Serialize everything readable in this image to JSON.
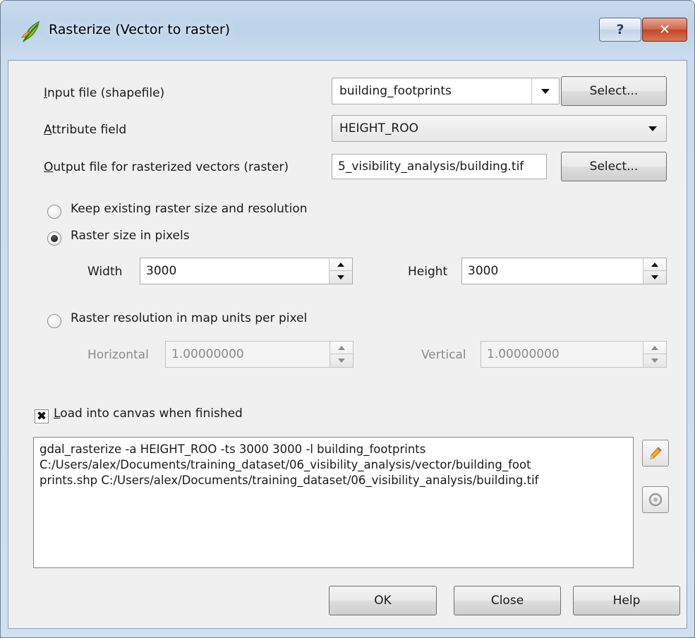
{
  "window": {
    "title": "Rasterize (Vector to raster)",
    "help_glyph": "?",
    "close_glyph": "✕",
    "icon": "qgis-leaf-icon"
  },
  "form": {
    "input_file": {
      "label_ul": "I",
      "label_rest": "nput file (shapefile)",
      "value": "building_footprints",
      "select_label": "Select..."
    },
    "attribute_field": {
      "label_ul": "A",
      "label_rest": "ttribute field",
      "value": "HEIGHT_ROO"
    },
    "output_file": {
      "label_ul": "O",
      "label_rest": "utput file for rasterized vectors (raster)",
      "value": "5_visibility_analysis/building.tif",
      "select_label": "Select..."
    }
  },
  "raster_options": {
    "keep_existing": {
      "label": "Keep existing raster size and resolution",
      "checked": false
    },
    "size_in_pixels": {
      "label": "Raster size in pixels",
      "checked": true
    },
    "width_label": "Width",
    "width_value": "3000",
    "height_label": "Height",
    "height_value": "3000",
    "resolution": {
      "label": "Raster resolution in map units per pixel",
      "checked": false
    },
    "horizontal_label": "Horizontal",
    "horizontal_value": "1.00000000",
    "vertical_label": "Vertical",
    "vertical_value": "1.00000000"
  },
  "load_canvas": {
    "checked": true,
    "mark": "✖",
    "label_ul": "L",
    "label_rest": "oad into canvas when finished"
  },
  "command": {
    "text": "gdal_rasterize -a HEIGHT_ROO -ts 3000 3000 -l building_footprints\nC:/Users/alex/Documents/training_dataset/06_visibility_analysis/vector/building_foot\nprints.shp C:/Users/alex/Documents/training_dataset/06_visibility_analysis/building.tif",
    "edit_icon": "pencil-icon",
    "reset_icon": "reset-icon"
  },
  "buttons": {
    "ok": "OK",
    "close": "Close",
    "help": "Help"
  }
}
